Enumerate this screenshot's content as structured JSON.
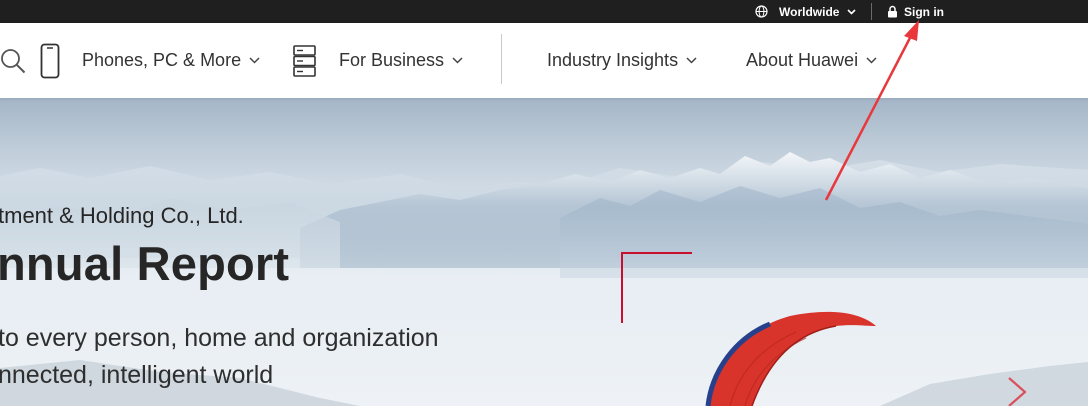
{
  "topbar": {
    "region_label": "Worldwide",
    "signin_label": "Sign in",
    "background_color": "#1f1f1f"
  },
  "nav": {
    "items": [
      {
        "label": "Phones, PC & More",
        "icon": "phone-icon"
      },
      {
        "label": "For Business",
        "icon": "server-icon"
      },
      {
        "label": "Industry Insights"
      },
      {
        "label": "About Huawei"
      }
    ],
    "search_icon": "search-icon"
  },
  "hero": {
    "subtitle": "tment & Holding Co., Ltd.",
    "title": "nnual Report",
    "tagline_line1": "to every person, home and organization",
    "tagline_line2": "nnected, intelligent world",
    "accent_color": "#c8102e",
    "next_icon": "chevron-right-icon"
  },
  "annotation": {
    "arrow_color": "#e8383c"
  }
}
